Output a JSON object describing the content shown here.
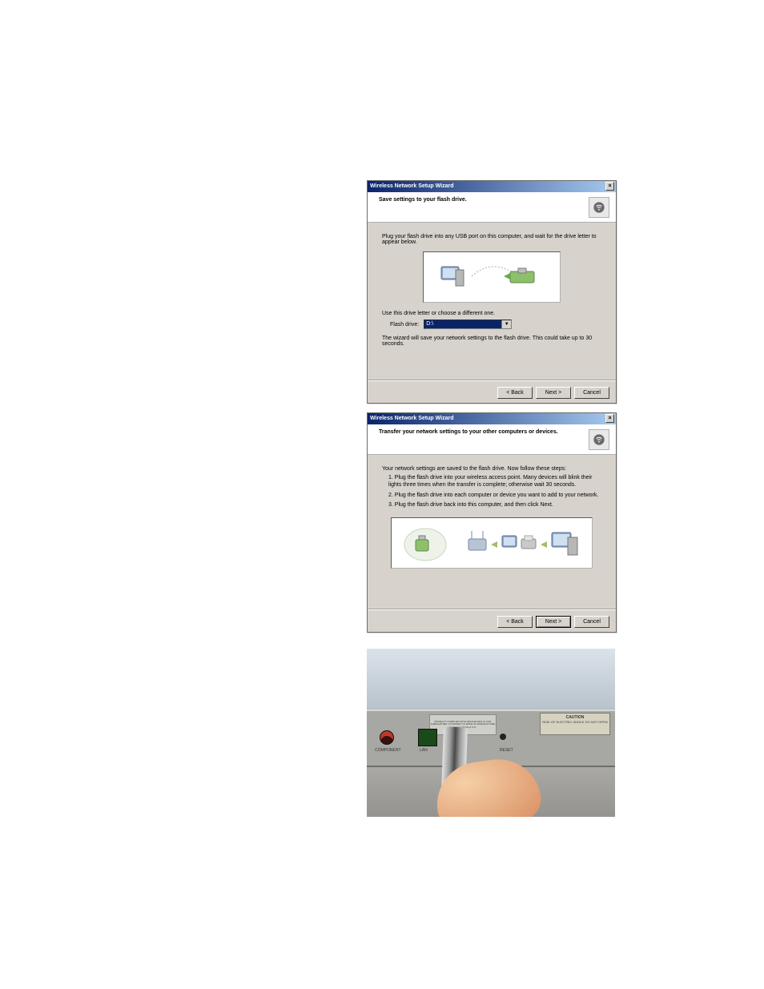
{
  "dialog1": {
    "window_title": "Wireless Network Setup Wizard",
    "header_title": "Save settings to your flash drive.",
    "instruction1": "Plug your flash drive into any USB port on this computer, and wait for the drive letter to appear below.",
    "instruction2": "Use this drive letter or choose a different one.",
    "field_label": "Flash drive:",
    "field_value": "D:\\",
    "instruction3": "The wizard will save your network settings to the flash drive. This could take up to 30 seconds.",
    "buttons": {
      "back": "< Back",
      "next": "Next >",
      "cancel": "Cancel"
    }
  },
  "dialog2": {
    "window_title": "Wireless Network Setup Wizard",
    "header_title": "Transfer your network settings to your other computers or devices.",
    "intro": "Your network settings are saved to the flash drive. Now follow these steps:",
    "step1": "1. Plug the flash drive into your wireless access point. Many devices will blink their lights three times when the transfer is complete; otherwise wait 30 seconds.",
    "step2": "2. Plug the flash drive into each computer or device you want to add to your network.",
    "step3": "3. Plug the flash drive back into this computer, and then click Next.",
    "buttons": {
      "back": "< Back",
      "next": "Next >",
      "cancel": "Cancel"
    }
  },
  "photo": {
    "caution_title": "CAUTION",
    "caution_lines": "RISK OF ELECTRIC SHOCK\nDO NOT OPEN",
    "port_component": "COMPONENT",
    "port_lan": "LAN",
    "port_reset": "RESET",
    "plate_line1": "PRODUCT COMPLIES WITH DHHS RULES 21 CFR",
    "plate_line2": "SUBCHAPTER J IN EFFECT AT DATE OF MANUFACTURE",
    "plate_line3": "Apparatus Claims of U.S."
  },
  "icons": {
    "wizard_icon": "wireless-wizard-icon",
    "close": "×"
  }
}
